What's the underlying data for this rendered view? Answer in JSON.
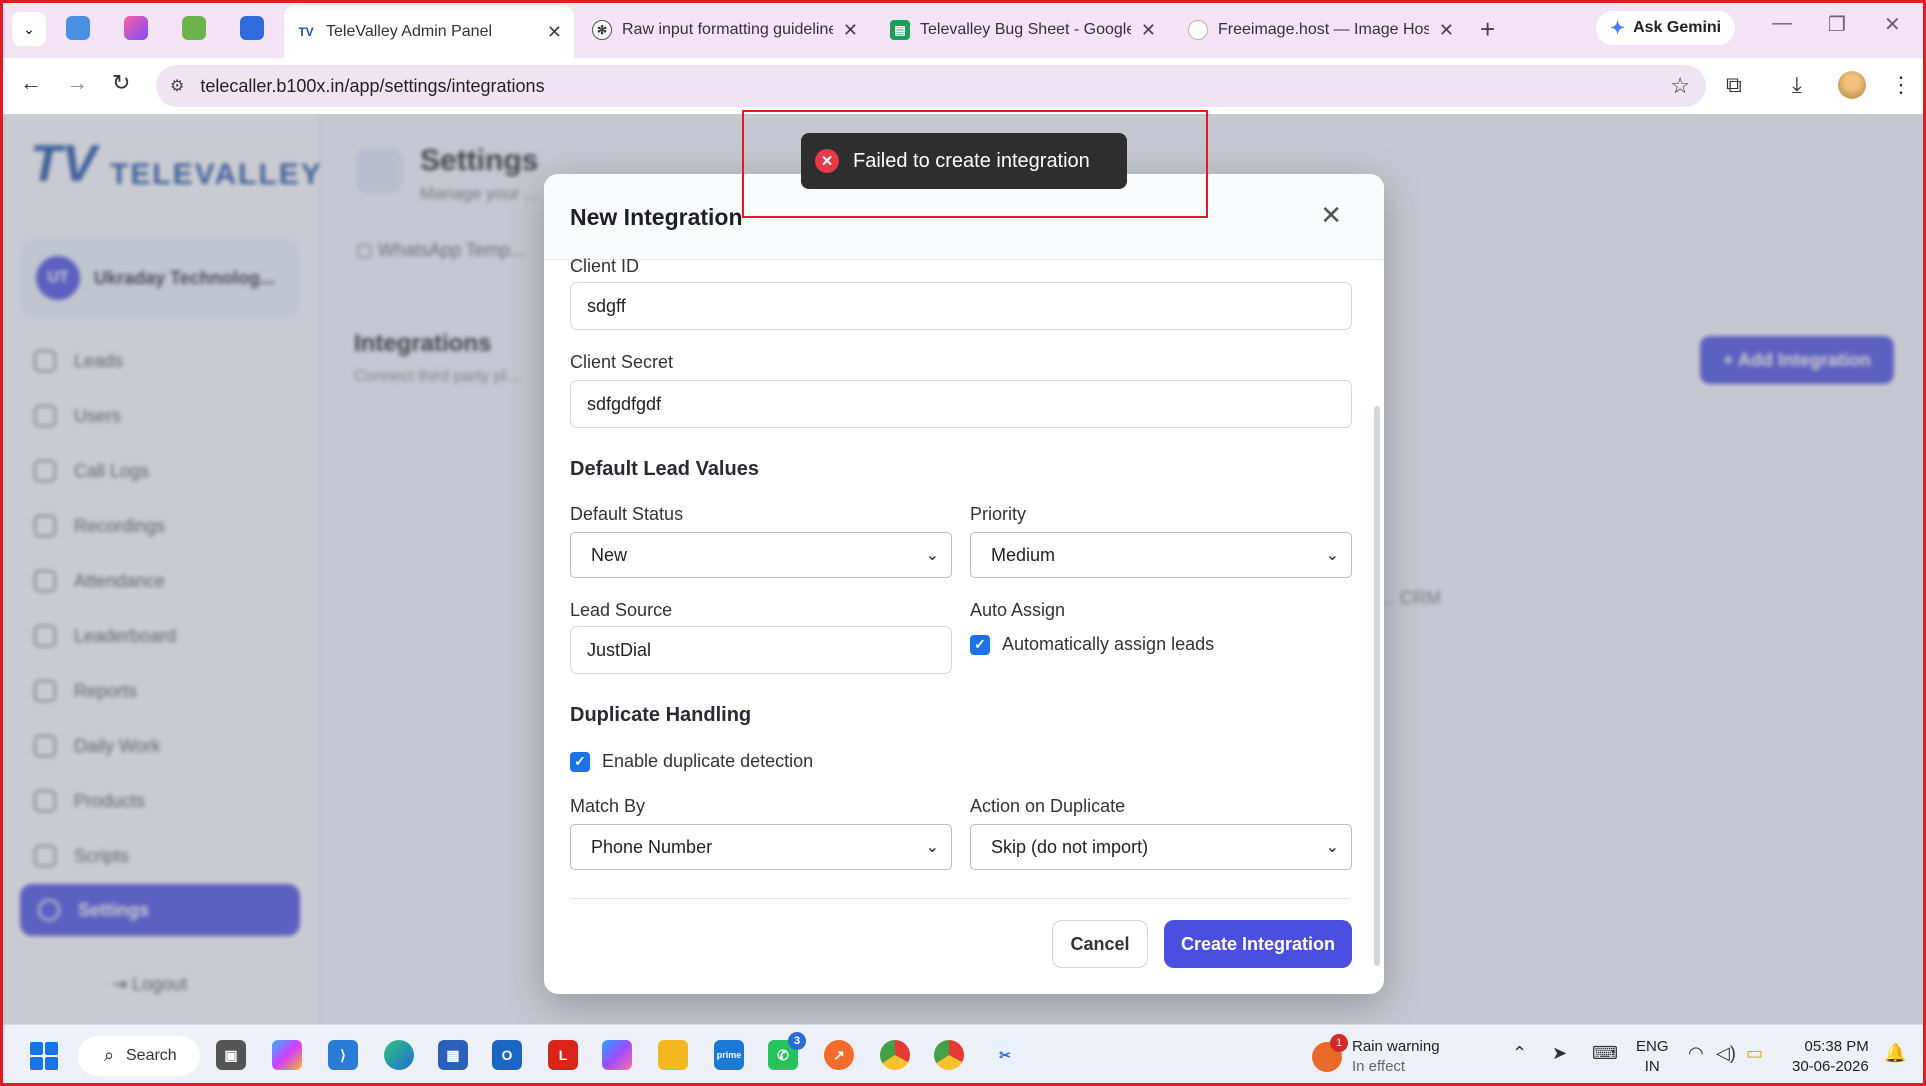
{
  "browser": {
    "tabs": [
      {
        "title": "TeleValley Admin Panel",
        "active": true
      },
      {
        "title": "Raw input formatting guideline",
        "active": false
      },
      {
        "title": "Televalley Bug Sheet - Google S",
        "active": false
      },
      {
        "title": "Freeimage.host — Image Hosti",
        "active": false
      }
    ],
    "gemini_label": "Ask Gemini",
    "url": "telecaller.b100x.in/app/settings/integrations"
  },
  "background_page": {
    "logo_text": "TELEVALLEY",
    "workspace_name": "Ukraday Technolog...",
    "nav_items": [
      "Leads",
      "Users",
      "Call Logs",
      "Recordings",
      "Attendance",
      "Leaderboard",
      "Reports",
      "Daily Work",
      "Products",
      "Scripts"
    ],
    "nav_active": "Settings",
    "logout": "Logout",
    "settings_title": "Settings",
    "settings_sub": "Manage your ...",
    "tab_label": "WhatsApp Temp...",
    "integrations_title": "Integrations",
    "integrations_sub": "Connect third party pl...",
    "add_integration": "+ Add Integration",
    "crm_text": "... CRM"
  },
  "toast": {
    "message": "Failed to create integration",
    "type": "error"
  },
  "modal": {
    "title": "New Integration",
    "client_id": {
      "label": "Client ID",
      "value": "sdgff"
    },
    "client_secret": {
      "label": "Client Secret",
      "value": "sdfgdfgdf"
    },
    "default_lead_values_heading": "Default Lead Values",
    "default_status": {
      "label": "Default Status",
      "value": "New"
    },
    "priority": {
      "label": "Priority",
      "value": "Medium"
    },
    "lead_source": {
      "label": "Lead Source",
      "value": "JustDial"
    },
    "auto_assign": {
      "label": "Auto Assign",
      "checkbox_label": "Automatically assign leads",
      "checked": true
    },
    "duplicate_handling_heading": "Duplicate Handling",
    "duplicate_detection": {
      "label": "Enable duplicate detection",
      "checked": true
    },
    "match_by": {
      "label": "Match By",
      "value": "Phone Number"
    },
    "action_on_duplicate": {
      "label": "Action on Duplicate",
      "value": "Skip (do not import)"
    },
    "cancel_label": "Cancel",
    "create_label": "Create Integration"
  },
  "taskbar": {
    "search_label": "Search",
    "whatsapp_badge": "3",
    "weather": {
      "title": "Rain warning",
      "sub": "In effect",
      "badge": "1"
    },
    "lang_1": "ENG",
    "lang_2": "IN",
    "time": "05:38 PM",
    "date": "30-06-2026"
  },
  "colors": {
    "accent": "#4a4fe0",
    "checkbox": "#1a73e8",
    "toast_bg": "#2e2e2e",
    "error": "#e8394a",
    "annotation_red": "#e01b24"
  }
}
